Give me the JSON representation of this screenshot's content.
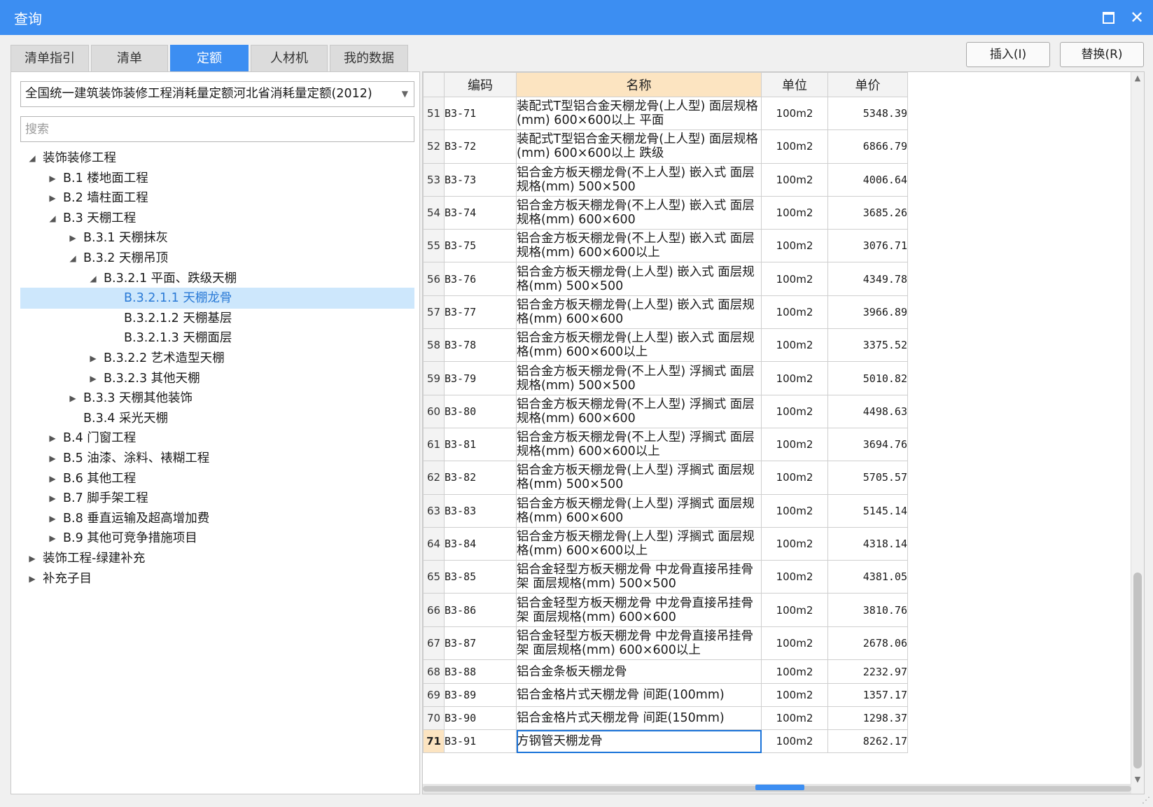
{
  "window": {
    "title": "查询"
  },
  "tabs": [
    {
      "label": "清单指引",
      "active": false
    },
    {
      "label": "清单",
      "active": false
    },
    {
      "label": "定额",
      "active": true
    },
    {
      "label": "人材机",
      "active": false
    },
    {
      "label": "我的数据",
      "active": false
    }
  ],
  "buttons": {
    "insert": "插入(I)",
    "replace": "替换(R)"
  },
  "selector": {
    "value": "全国统一建筑装饰装修工程消耗量定额河北省消耗量定额(2012)"
  },
  "search": {
    "placeholder": "搜索"
  },
  "tree": [
    {
      "label": "装饰装修工程",
      "level": 0,
      "arrow": "expanded"
    },
    {
      "label": "B.1 楼地面工程",
      "level": 1,
      "arrow": "collapsed"
    },
    {
      "label": "B.2 墙柱面工程",
      "level": 1,
      "arrow": "collapsed"
    },
    {
      "label": "B.3 天棚工程",
      "level": 1,
      "arrow": "expanded"
    },
    {
      "label": "B.3.1 天棚抹灰",
      "level": 2,
      "arrow": "collapsed"
    },
    {
      "label": "B.3.2 天棚吊顶",
      "level": 2,
      "arrow": "expanded"
    },
    {
      "label": "B.3.2.1 平面、跌级天棚",
      "level": 3,
      "arrow": "expanded"
    },
    {
      "label": "B.3.2.1.1 天棚龙骨",
      "level": 4,
      "arrow": "none",
      "selected": true
    },
    {
      "label": "B.3.2.1.2 天棚基层",
      "level": 4,
      "arrow": "none"
    },
    {
      "label": "B.3.2.1.3 天棚面层",
      "level": 4,
      "arrow": "none"
    },
    {
      "label": "B.3.2.2 艺术造型天棚",
      "level": 3,
      "arrow": "collapsed"
    },
    {
      "label": "B.3.2.3 其他天棚",
      "level": 3,
      "arrow": "collapsed"
    },
    {
      "label": "B.3.3 天棚其他装饰",
      "level": 2,
      "arrow": "collapsed"
    },
    {
      "label": "B.3.4 采光天棚",
      "level": 2,
      "arrow": "none"
    },
    {
      "label": "B.4 门窗工程",
      "level": 1,
      "arrow": "collapsed"
    },
    {
      "label": "B.5 油漆、涂料、裱糊工程",
      "level": 1,
      "arrow": "collapsed"
    },
    {
      "label": "B.6 其他工程",
      "level": 1,
      "arrow": "collapsed"
    },
    {
      "label": "B.7 脚手架工程",
      "level": 1,
      "arrow": "collapsed"
    },
    {
      "label": "B.8 垂直运输及超高增加费",
      "level": 1,
      "arrow": "collapsed"
    },
    {
      "label": "B.9 其他可竞争措施项目",
      "level": 1,
      "arrow": "collapsed"
    },
    {
      "label": "装饰工程-绿建补充",
      "level": 0,
      "arrow": "collapsed"
    },
    {
      "label": "补充子目",
      "level": 0,
      "arrow": "collapsed"
    }
  ],
  "table": {
    "headers": {
      "code": "编码",
      "name": "名称",
      "unit": "单位",
      "price": "单价"
    },
    "current_row": "71",
    "rows": [
      {
        "idx": "51",
        "code": "B3-71",
        "name": "装配式T型铝合金天棚龙骨(上人型) 面层规格(mm) 600×600以上 平面",
        "unit": "100m2",
        "price": "5348.39"
      },
      {
        "idx": "52",
        "code": "B3-72",
        "name": "装配式T型铝合金天棚龙骨(上人型) 面层规格(mm) 600×600以上 跌级",
        "unit": "100m2",
        "price": "6866.79"
      },
      {
        "idx": "53",
        "code": "B3-73",
        "name": "铝合金方板天棚龙骨(不上人型) 嵌入式 面层规格(mm) 500×500",
        "unit": "100m2",
        "price": "4006.64"
      },
      {
        "idx": "54",
        "code": "B3-74",
        "name": "铝合金方板天棚龙骨(不上人型) 嵌入式 面层规格(mm) 600×600",
        "unit": "100m2",
        "price": "3685.26"
      },
      {
        "idx": "55",
        "code": "B3-75",
        "name": "铝合金方板天棚龙骨(不上人型) 嵌入式 面层规格(mm) 600×600以上",
        "unit": "100m2",
        "price": "3076.71"
      },
      {
        "idx": "56",
        "code": "B3-76",
        "name": "铝合金方板天棚龙骨(上人型) 嵌入式 面层规格(mm) 500×500",
        "unit": "100m2",
        "price": "4349.78"
      },
      {
        "idx": "57",
        "code": "B3-77",
        "name": "铝合金方板天棚龙骨(上人型) 嵌入式 面层规格(mm) 600×600",
        "unit": "100m2",
        "price": "3966.89"
      },
      {
        "idx": "58",
        "code": "B3-78",
        "name": "铝合金方板天棚龙骨(上人型) 嵌入式 面层规格(mm) 600×600以上",
        "unit": "100m2",
        "price": "3375.52"
      },
      {
        "idx": "59",
        "code": "B3-79",
        "name": "铝合金方板天棚龙骨(不上人型) 浮搁式 面层规格(mm) 500×500",
        "unit": "100m2",
        "price": "5010.82"
      },
      {
        "idx": "60",
        "code": "B3-80",
        "name": "铝合金方板天棚龙骨(不上人型) 浮搁式 面层规格(mm) 600×600",
        "unit": "100m2",
        "price": "4498.63"
      },
      {
        "idx": "61",
        "code": "B3-81",
        "name": "铝合金方板天棚龙骨(不上人型) 浮搁式 面层规格(mm) 600×600以上",
        "unit": "100m2",
        "price": "3694.76"
      },
      {
        "idx": "62",
        "code": "B3-82",
        "name": "铝合金方板天棚龙骨(上人型) 浮搁式 面层规格(mm) 500×500",
        "unit": "100m2",
        "price": "5705.57"
      },
      {
        "idx": "63",
        "code": "B3-83",
        "name": "铝合金方板天棚龙骨(上人型) 浮搁式 面层规格(mm) 600×600",
        "unit": "100m2",
        "price": "5145.14"
      },
      {
        "idx": "64",
        "code": "B3-84",
        "name": "铝合金方板天棚龙骨(上人型) 浮搁式 面层规格(mm) 600×600以上",
        "unit": "100m2",
        "price": "4318.14"
      },
      {
        "idx": "65",
        "code": "B3-85",
        "name": "铝合金轻型方板天棚龙骨 中龙骨直接吊挂骨架 面层规格(mm) 500×500",
        "unit": "100m2",
        "price": "4381.05"
      },
      {
        "idx": "66",
        "code": "B3-86",
        "name": "铝合金轻型方板天棚龙骨 中龙骨直接吊挂骨架 面层规格(mm) 600×600",
        "unit": "100m2",
        "price": "3810.76"
      },
      {
        "idx": "67",
        "code": "B3-87",
        "name": "铝合金轻型方板天棚龙骨 中龙骨直接吊挂骨架 面层规格(mm) 600×600以上",
        "unit": "100m2",
        "price": "2678.06"
      },
      {
        "idx": "68",
        "code": "B3-88",
        "name": "铝合金条板天棚龙骨",
        "unit": "100m2",
        "price": "2232.97"
      },
      {
        "idx": "69",
        "code": "B3-89",
        "name": "铝合金格片式天棚龙骨 间距(100mm)",
        "unit": "100m2",
        "price": "1357.17"
      },
      {
        "idx": "70",
        "code": "B3-90",
        "name": "铝合金格片式天棚龙骨 间距(150mm)",
        "unit": "100m2",
        "price": "1298.37"
      },
      {
        "idx": "71",
        "code": "B3-91",
        "name": "方钢管天棚龙骨",
        "unit": "100m2",
        "price": "8262.17"
      }
    ]
  }
}
